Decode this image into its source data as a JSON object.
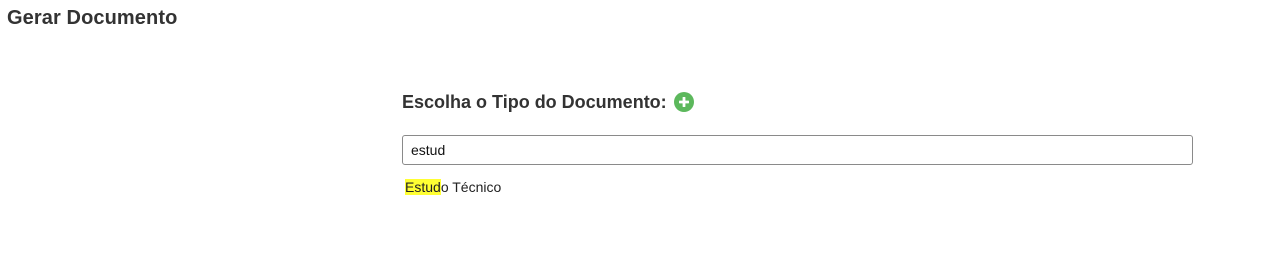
{
  "page": {
    "title": "Gerar Documento"
  },
  "document_type": {
    "heading": "Escolha o Tipo do Documento:",
    "add_icon": "plus-circle-icon",
    "add_icon_color": "#5cb85c",
    "search_value": "estud",
    "results": [
      {
        "match": "Estud",
        "rest": "o Técnico"
      }
    ],
    "highlight_color": "#ffff33"
  }
}
